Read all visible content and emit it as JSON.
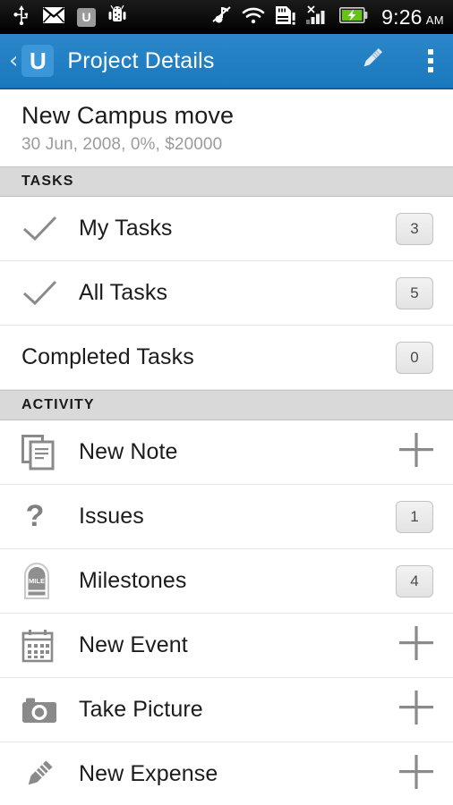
{
  "statusbar": {
    "left_icons": [
      "usb-icon",
      "gmail-icon",
      "u-app-icon",
      "android-icon"
    ],
    "u_badge_label": "U",
    "right_icons": [
      "mute-icon",
      "wifi-icon",
      "sd-card-warning-icon",
      "no-signal-icon",
      "battery-charging-icon"
    ],
    "time": "9:26",
    "ampm": "AM"
  },
  "actionbar": {
    "back_label": "‹",
    "logo_label": "U",
    "title": "Project Details",
    "edit_icon": "pencil-icon",
    "overflow_icon": "overflow-menu-icon",
    "bg_color": "#1f7fc4",
    "logo_bg_color": "#3c97d8"
  },
  "project": {
    "title": "New Campus move",
    "subtitle": "30 Jun, 2008, 0%, $20000"
  },
  "sections": [
    {
      "header": "TASKS",
      "rows": [
        {
          "label": "My Tasks",
          "icon": "check-icon",
          "badge": "3",
          "action": "badge"
        },
        {
          "label": "All Tasks",
          "icon": "check-icon",
          "badge": "5",
          "action": "badge"
        },
        {
          "label": "Completed Tasks",
          "icon": "",
          "badge": "0",
          "action": "badge"
        }
      ]
    },
    {
      "header": "ACTIVITY",
      "rows": [
        {
          "label": "New Note",
          "icon": "documents-icon",
          "badge": "",
          "action": "plus"
        },
        {
          "label": "Issues",
          "icon": "question-mark-icon",
          "badge": "1",
          "action": "badge"
        },
        {
          "label": "Milestones",
          "icon": "milestone-icon",
          "badge": "4",
          "action": "badge"
        },
        {
          "label": "New Event",
          "icon": "calendar-icon",
          "badge": "",
          "action": "plus"
        },
        {
          "label": "Take Picture",
          "icon": "camera-icon",
          "badge": "",
          "action": "plus"
        },
        {
          "label": "New Expense",
          "icon": "expense-pencil-icon",
          "badge": "",
          "action": "plus"
        }
      ]
    }
  ],
  "milestone_icon_text": "MILE"
}
